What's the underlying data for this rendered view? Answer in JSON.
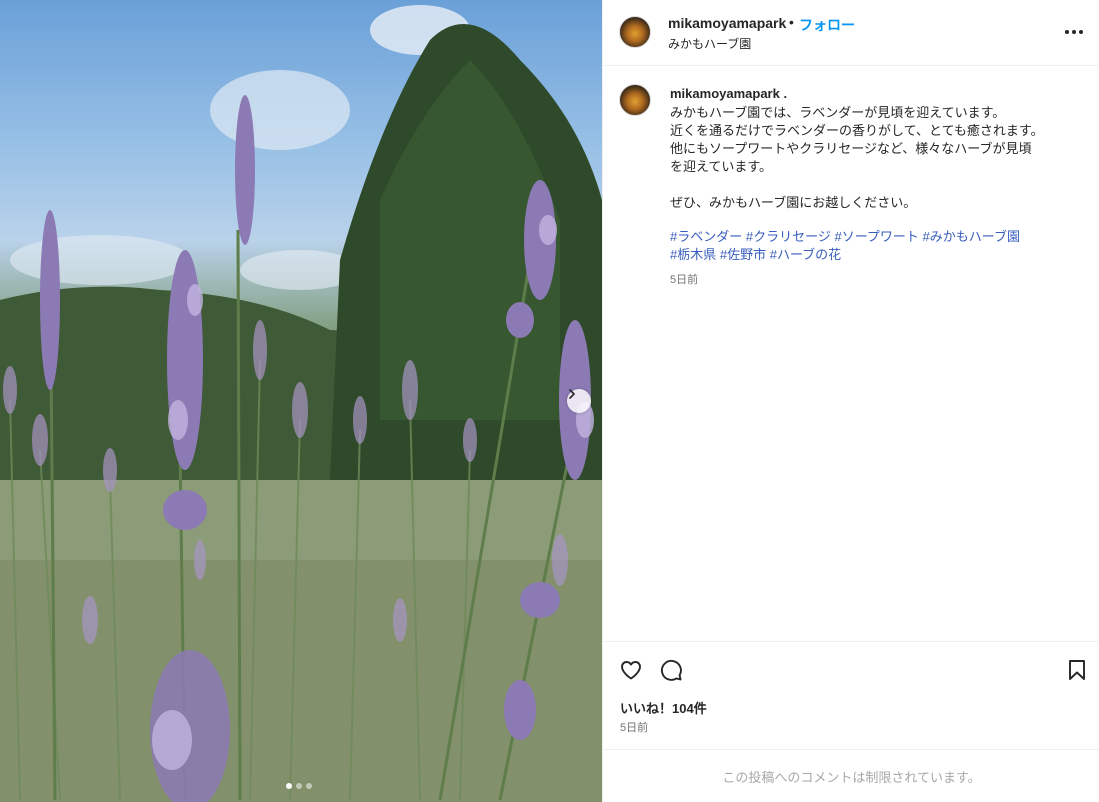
{
  "post": {
    "username": "mikamoyamapark",
    "separator": "•",
    "follow_label": "フォロー",
    "location": "みかもハーブ園",
    "more_icon": "more-horizontal-icon"
  },
  "caption": {
    "username": "mikamoyamapark .",
    "lines": [
      "みかもハーブ園では、ラベンダーが見頃を迎えています。",
      "近くを通るだけでラベンダーの香りがして、とても癒されます。",
      "他にもソープワートやクラリセージなど、様々なハーブが見頃",
      "を迎えています。",
      "",
      "ぜひ、みかもハーブ園にお越しください。"
    ],
    "hashtags": [
      "#ラベンダー",
      "#クラリセージ",
      "#ソープワート",
      "#みかもハーブ園",
      "#栃木県",
      "#佐野市",
      "#ハーブの花"
    ],
    "time": "5日前"
  },
  "actions": {
    "like_icon": "heart-icon",
    "comment_icon": "comment-icon",
    "save_icon": "bookmark-icon",
    "likes_text": "いいね！104件",
    "time": "5日前"
  },
  "comments_disabled": "この投稿へのコメントは制限されています。",
  "carousel": {
    "next_icon": "chevron-right-icon",
    "slide_count": 3,
    "active_slide": 1
  },
  "colors": {
    "follow": "#0095f6",
    "hashtag": "#385dbc",
    "muted": "#737373",
    "border": "#efefef"
  }
}
